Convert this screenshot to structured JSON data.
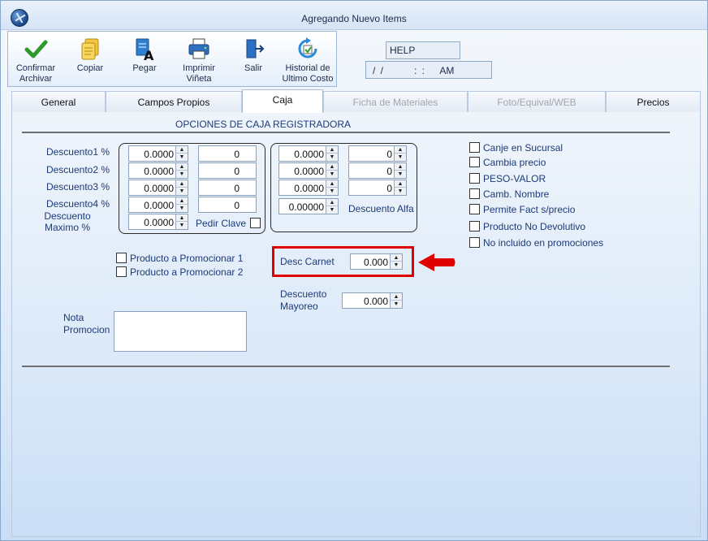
{
  "window": {
    "title": "Agregando Nuevo Items"
  },
  "toolbar": {
    "confirm": "Confirmar\nArchivar",
    "copy": "Copiar",
    "paste": "Pegar",
    "print": "Imprimir\nViñeta",
    "exit": "Salir",
    "history": "Historial de\nUltimo Costo"
  },
  "header": {
    "help": "HELP",
    "datetime": "/ /      : :   AM"
  },
  "tabs": [
    {
      "label": "General"
    },
    {
      "label": "Campos Propios"
    },
    {
      "label": "Caja"
    },
    {
      "label": "Ficha de Materiales"
    },
    {
      "label": "Foto/Equival/WEB"
    },
    {
      "label": "Precios"
    }
  ],
  "caja": {
    "section_title": "OPCIONES DE CAJA REGISTRADORA",
    "labels": {
      "d1": "Descuento1 %",
      "d2": "Descuento2 %",
      "d3": "Descuento3 %",
      "d4": "Descuento4 %",
      "dmax": "Descuento\nMaximo %",
      "pedir_clave": "Pedir Clave",
      "descuento_alfa": "Descuento Alfa",
      "desc_carnet": "Desc Carnet",
      "desc_mayoreo": "Descuento\nMayoreo",
      "nota": "Nota\nPromocion"
    },
    "group1_left": [
      "0.0000",
      "0.0000",
      "0.0000",
      "0.0000",
      "0.0000"
    ],
    "group1_right": [
      "0",
      "0",
      "0",
      "0"
    ],
    "group2_left": [
      "0.0000",
      "0.0000",
      "0.0000",
      "0.00000"
    ],
    "group2_right": [
      "0",
      "0",
      "0"
    ],
    "desc_carnet_value": "0.000",
    "desc_mayoreo_value": "0.000",
    "promos": [
      "Producto a Promocionar 1",
      "Producto a Promocionar 2"
    ],
    "options": [
      "Canje en Sucursal",
      "Cambia precio",
      "PESO-VALOR",
      "Camb. Nombre",
      "Permite Fact s/precio",
      "Producto No Devolutivo",
      "No incluido en promociones"
    ]
  },
  "colors": {
    "highlight": "#e00000",
    "label": "#1c3a78"
  }
}
